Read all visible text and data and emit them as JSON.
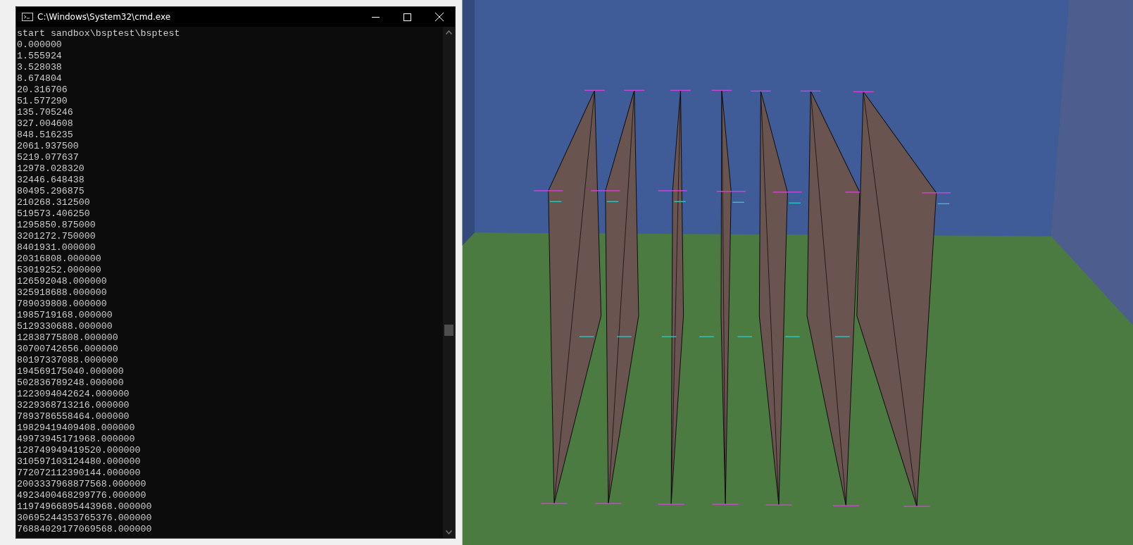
{
  "window": {
    "title": "C:\\Windows\\System32\\cmd.exe"
  },
  "console": {
    "lines": [
      "start sandbox\\bsptest\\bsptest",
      "0.000000",
      "1.555924",
      "3.528038",
      "8.674804",
      "20.316706",
      "51.577290",
      "135.705246",
      "327.004608",
      "848.516235",
      "2061.937500",
      "5219.077637",
      "12978.028320",
      "32446.648438",
      "80495.296875",
      "210268.312500",
      "519573.406250",
      "1295850.875000",
      "3201272.750000",
      "8401931.000000",
      "20316808.000000",
      "53019252.000000",
      "126592048.000000",
      "325918688.000000",
      "789039808.000000",
      "1985719168.000000",
      "5129330688.000000",
      "12838775808.000000",
      "30700742656.000000",
      "80197337088.000000",
      "194569175040.000000",
      "502836789248.000000",
      "1223094042624.000000",
      "3229368713216.000000",
      "7893786558464.000000",
      "19829419409408.000000",
      "49973945171968.000000",
      "128749949419520.000000",
      "310597103124480.000000",
      "772072112390144.000000",
      "2003337968877568.000000",
      "4923400468299776.000000",
      "11974966895443968.000000",
      "30695244353765376.000000",
      "76884029177069568.000000"
    ]
  }
}
